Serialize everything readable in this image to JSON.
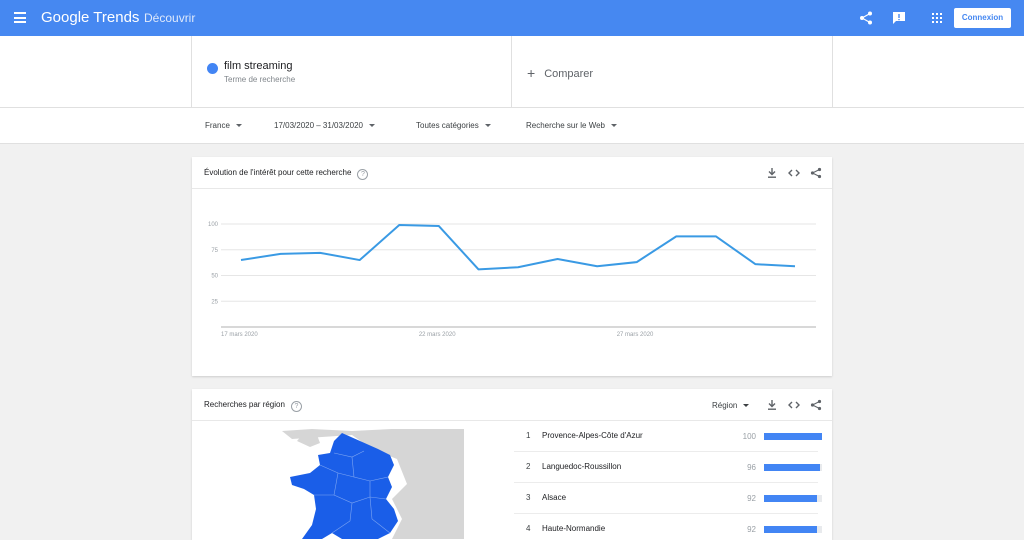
{
  "header": {
    "brand_google": "Google",
    "brand_trends": "Trends",
    "discover": "Découvrir",
    "login": "Connexion",
    "icons": [
      "menu-icon",
      "share-icon",
      "feedback-icon",
      "apps-icon"
    ],
    "bar_color": "#4688f1"
  },
  "search": {
    "term": "film streaming",
    "term_type": "Terme de recherche",
    "term_color": "#4285f4",
    "compare_icon": "+",
    "compare_label": "Comparer"
  },
  "filters": {
    "country": "France",
    "date_range": "17/03/2020 – 31/03/2020",
    "category": "Toutes catégories",
    "search_type": "Recherche sur le Web"
  },
  "interest_card": {
    "title": "Évolution de l'intérêt pour cette recherche",
    "help": "?",
    "icons": [
      "download-icon",
      "embed-icon",
      "share-icon"
    ]
  },
  "chart_data": {
    "type": "line",
    "title": "",
    "xlabel": "",
    "ylabel": "",
    "ylim": [
      0,
      100
    ],
    "yticks": [
      25,
      50,
      75,
      100
    ],
    "grid": true,
    "x": [
      "17/03/2020",
      "18/03/2020",
      "19/03/2020",
      "20/03/2020",
      "21/03/2020",
      "22/03/2020",
      "23/03/2020",
      "24/03/2020",
      "25/03/2020",
      "26/03/2020",
      "27/03/2020",
      "28/03/2020",
      "29/03/2020",
      "30/03/2020",
      "31/03/2020"
    ],
    "xtick_labels": [
      {
        "index": 0,
        "label": "17 mars 2020"
      },
      {
        "index": 5,
        "label": "22 mars 2020"
      },
      {
        "index": 10,
        "label": "27 mars 2020"
      }
    ],
    "series": [
      {
        "color": "#3a9ae4",
        "values": [
          65,
          71,
          72,
          65,
          99,
          98,
          56,
          58,
          66,
          59,
          63,
          88,
          88,
          61,
          59
        ]
      }
    ]
  },
  "region_card": {
    "title": "Recherches par région",
    "help": "?",
    "resolution_label": "Région",
    "icons": [
      "download-icon",
      "embed-icon",
      "share-icon"
    ],
    "map_color": "#1a5ee8",
    "rows": [
      {
        "rank": "1",
        "name": "Provence-Alpes-Côte d'Azur",
        "value": "100",
        "value_num": 100
      },
      {
        "rank": "2",
        "name": "Languedoc-Roussillon",
        "value": "96",
        "value_num": 96
      },
      {
        "rank": "3",
        "name": "Alsace",
        "value": "92",
        "value_num": 92
      },
      {
        "rank": "4",
        "name": "Haute-Normandie",
        "value": "92",
        "value_num": 92
      }
    ]
  }
}
